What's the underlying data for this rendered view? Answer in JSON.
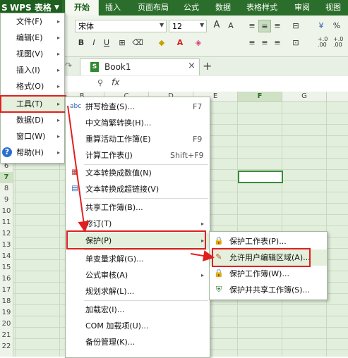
{
  "app": {
    "logo": "S",
    "title": "WPS 表格",
    "menu_arrow": "▼"
  },
  "ribbon_tabs": [
    "开始",
    "插入",
    "页面布局",
    "公式",
    "数据",
    "表格样式",
    "审阅",
    "视图"
  ],
  "ribbon": {
    "font_name": "宋体",
    "font_size": "12",
    "bold": "B",
    "italic": "I",
    "underline": "U",
    "grow_font": "A",
    "shrink_font": "A",
    "decimal_add": ".00",
    "decimal_add_sub": "+.0",
    "decimal_remove": ".00",
    "decimal_remove_sub": "+.0",
    "percent": "%"
  },
  "doc_tab": {
    "name": "Book1",
    "close": "×",
    "new": "+"
  },
  "formula_bar": {
    "fx": "fx"
  },
  "columns": [
    "B",
    "C",
    "D",
    "E",
    "F",
    "G"
  ],
  "rows": [
    "6",
    "7",
    "8",
    "9",
    "10",
    "11",
    "12",
    "13",
    "14",
    "15",
    "16",
    "17",
    "18",
    "19",
    "20",
    "21",
    "22"
  ],
  "main_menu": {
    "items": [
      {
        "label": "文件(F)"
      },
      {
        "label": "编辑(E)"
      },
      {
        "label": "视图(V)"
      },
      {
        "label": "插入(I)"
      },
      {
        "label": "格式(O)"
      },
      {
        "label": "工具(T)"
      },
      {
        "label": "数据(D)"
      },
      {
        "label": "窗口(W)"
      },
      {
        "label": "帮助(H)"
      }
    ]
  },
  "tools_menu": {
    "items": [
      {
        "label": "拼写检查(S)...",
        "shortcut": "F7",
        "icon": "abc"
      },
      {
        "label": "中文简繁转换(H)..."
      },
      {
        "label": "重算活动工作簿(E)",
        "shortcut": "F9"
      },
      {
        "label": "计算工作表(J)",
        "shortcut": "Shift+F9"
      },
      {
        "label": "文本转换成数值(N)"
      },
      {
        "label": "文本转换成超链接(V)"
      },
      {
        "label": "共享工作簿(B)..."
      },
      {
        "label": "修订(T)"
      },
      {
        "label": "保护(P)"
      },
      {
        "label": "单变量求解(G)..."
      },
      {
        "label": "公式审核(A)"
      },
      {
        "label": "规划求解(L)..."
      },
      {
        "label": "加载宏(I)..."
      },
      {
        "label": "COM 加载项(U)..."
      },
      {
        "label": "备份管理(K)..."
      }
    ]
  },
  "protect_menu": {
    "items": [
      {
        "label": "保护工作表(P)..."
      },
      {
        "label": "允许用户编辑区域(A)..."
      },
      {
        "label": "保护工作簿(W)..."
      },
      {
        "label": "保护并共享工作簿(S)..."
      }
    ]
  },
  "colors": {
    "accent": "#2b6e2b",
    "highlight_red": "#e02020",
    "grid": "#e2efdc"
  }
}
